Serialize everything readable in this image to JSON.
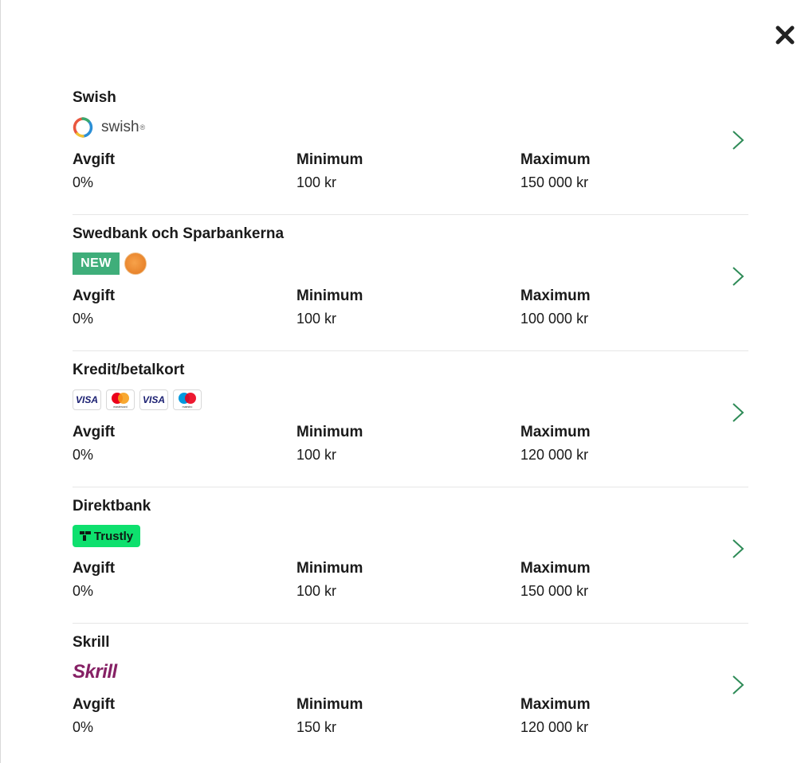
{
  "close_label": "close",
  "columns": {
    "fee": "Avgift",
    "min": "Minimum",
    "max": "Maximum"
  },
  "methods": [
    {
      "title": "Swish",
      "fee": "0%",
      "min": "100 kr",
      "max": "150 000 kr",
      "logo": {
        "text": "swish",
        "mark": "®"
      }
    },
    {
      "title": "Swedbank och Sparbankerna",
      "fee": "0%",
      "min": "100 kr",
      "max": "100 000 kr",
      "badge": "NEW"
    },
    {
      "title": "Kredit/betalkort",
      "fee": "0%",
      "min": "100 kr",
      "max": "120 000 kr",
      "cards": [
        "VISA",
        "mastercard",
        "VISA",
        "maestro"
      ]
    },
    {
      "title": "Direktbank",
      "fee": "0%",
      "min": "100 kr",
      "max": "150 000 kr",
      "logo": {
        "text": "Trustly"
      }
    },
    {
      "title": "Skrill",
      "fee": "0%",
      "min": "150 kr",
      "max": "120 000 kr",
      "logo": {
        "text": "Skrill"
      }
    }
  ],
  "colors": {
    "accent": "#2e8b57",
    "new_badge": "#3fae7a",
    "trustly": "#0ee06e",
    "skrill": "#862165"
  }
}
